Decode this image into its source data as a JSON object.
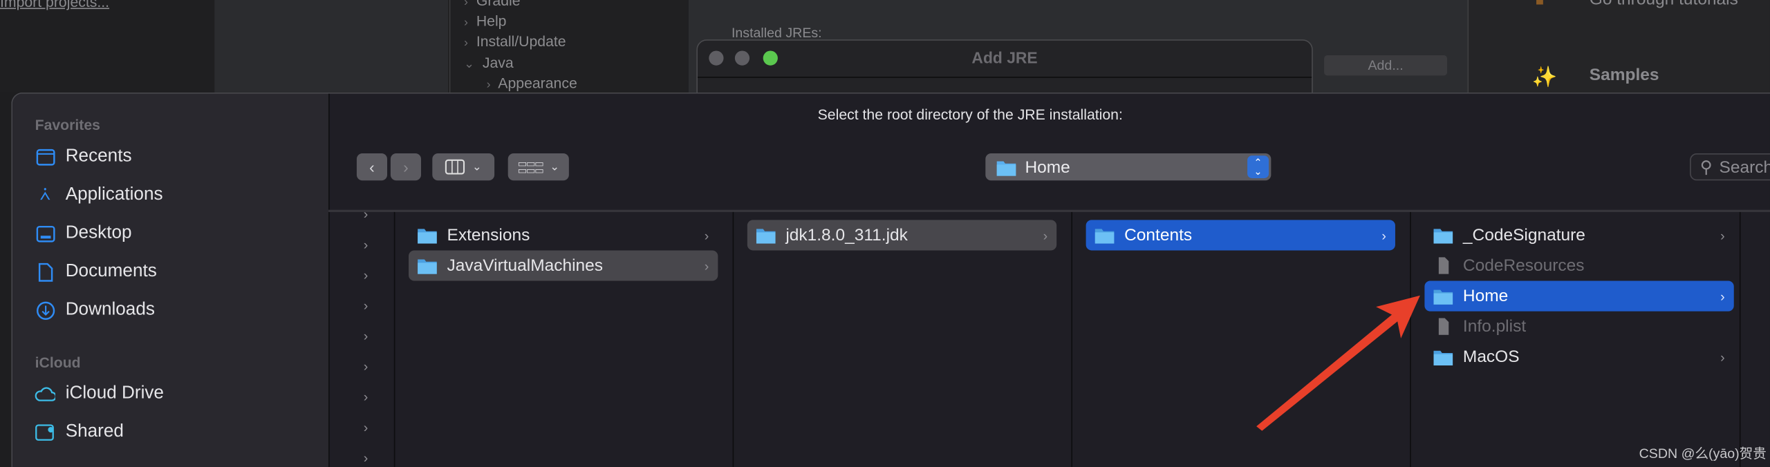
{
  "background": {
    "import_link": "Import projects...",
    "tree_items": [
      "Gradle",
      "Help",
      "Install/Update",
      "Java",
      "Appearance"
    ],
    "installed_jres_label": "Installed JREs:",
    "add_button": "Add...",
    "add_jre_title": "Add JRE",
    "tutorials_text": "Go through tutorials",
    "samples_title": "Samples"
  },
  "dialog": {
    "prompt": "Select the root directory of the JRE installation:",
    "path_popup": "Home",
    "search_placeholder": "Search"
  },
  "sidebar": {
    "favorites_label": "Favorites",
    "favorites": [
      {
        "label": "Recents",
        "icon": "recents-folder-icon"
      },
      {
        "label": "Applications",
        "icon": "applications-icon"
      },
      {
        "label": "Desktop",
        "icon": "desktop-icon"
      },
      {
        "label": "Documents",
        "icon": "document-icon"
      },
      {
        "label": "Downloads",
        "icon": "download-icon"
      }
    ],
    "icloud_label": "iCloud",
    "icloud": [
      {
        "label": "iCloud Drive",
        "icon": "cloud-icon"
      },
      {
        "label": "Shared",
        "icon": "shared-folder-icon"
      }
    ]
  },
  "columns": [
    {
      "items": [
        {
          "name": "Extensions",
          "kind": "folder"
        },
        {
          "name": "JavaVirtualMachines",
          "kind": "folder",
          "state": "selected-inactive"
        }
      ]
    },
    {
      "items": [
        {
          "name": "jdk1.8.0_311.jdk",
          "kind": "folder",
          "state": "selected-inactive"
        }
      ]
    },
    {
      "items": [
        {
          "name": "Contents",
          "kind": "folder",
          "state": "selected"
        }
      ]
    },
    {
      "items": [
        {
          "name": "_CodeSignature",
          "kind": "folder"
        },
        {
          "name": "CodeResources",
          "kind": "file",
          "state": "disabled"
        },
        {
          "name": "Home",
          "kind": "folder",
          "state": "selected"
        },
        {
          "name": "Info.plist",
          "kind": "file",
          "state": "disabled"
        },
        {
          "name": "MacOS",
          "kind": "folder"
        }
      ]
    }
  ],
  "colors": {
    "selection": "#1f5ccc",
    "folder": "#5ab0ef",
    "annotation_arrow": "#e8402a"
  },
  "watermark": "CSDN @么(yāo)贺贵"
}
